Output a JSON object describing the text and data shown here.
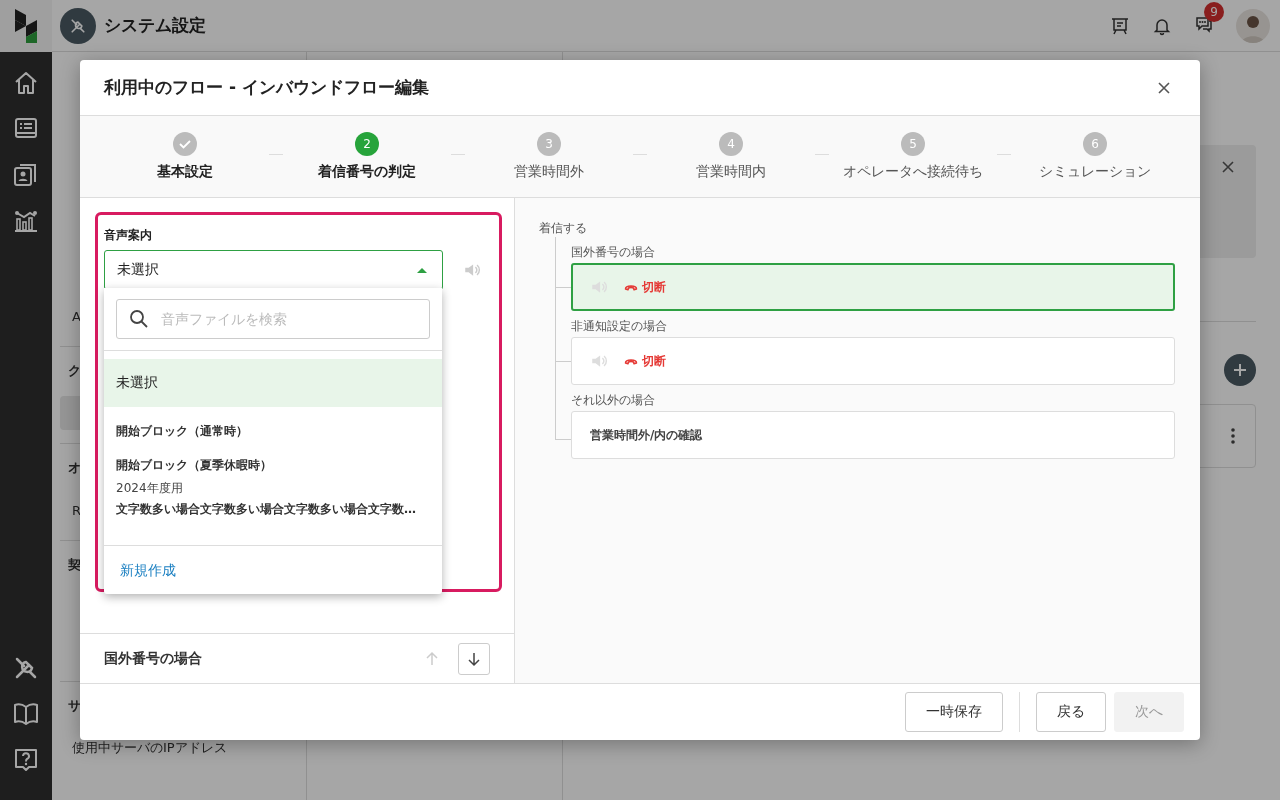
{
  "app": {
    "title": "システム設定",
    "chat_badge": "9"
  },
  "background_nav": {
    "items": [
      {
        "kind": "item",
        "text": "A",
        "selected": false
      },
      {
        "kind": "heading",
        "text": "ク"
      },
      {
        "kind": "item",
        "selected": true
      },
      {
        "kind": "heading",
        "text": "オ"
      },
      {
        "kind": "item",
        "text": "R",
        "selected": false
      },
      {
        "kind": "heading",
        "text": "契"
      },
      {
        "kind": "heading",
        "text": "サ"
      },
      {
        "kind": "item",
        "text": "使用中サーバのIPアドレス",
        "selected": false
      }
    ]
  },
  "modal": {
    "title": "利用中のフロー - インバウンドフロー編集",
    "steps": [
      {
        "label": "基本設定",
        "completed": true,
        "selected": false
      },
      {
        "number": "2",
        "label": "着信番号の判定",
        "completed": false,
        "selected": true
      },
      {
        "number": "3",
        "label": "営業時間外",
        "completed": false,
        "selected": false
      },
      {
        "number": "4",
        "label": "営業時間内",
        "completed": false,
        "selected": false
      },
      {
        "number": "5",
        "label": "オペレータへ接続待ち",
        "completed": false,
        "selected": false
      },
      {
        "number": "6",
        "label": "シミュレーション",
        "completed": false,
        "selected": false
      }
    ],
    "voice_guide": {
      "label": "音声案内",
      "value": "未選択",
      "expanded": true,
      "search_placeholder": "音声ファイルを検索",
      "options": [
        {
          "kind": "empty",
          "title": "未選択",
          "selected": true
        },
        {
          "kind": "file",
          "title": "開始ブロック（通常時）",
          "selected": false
        },
        {
          "kind": "file",
          "title": "開始ブロック（夏季休暇時）",
          "subtitle": "2024年度用",
          "selected": false
        },
        {
          "kind": "file",
          "title": "文字数多い場合文字数多い場合文字数多い場合文字数…",
          "selected": false
        }
      ],
      "create_link": "新規作成"
    },
    "section": {
      "title": "国外番号の場合",
      "move_up_disabled": true,
      "move_down_disabled": false
    },
    "flow": {
      "root": "着信する",
      "branches": [
        {
          "condition": "国外番号の場合",
          "kind": "hangup",
          "action": "切断",
          "selected": true
        },
        {
          "condition": "非通知設定の場合",
          "kind": "hangup",
          "action": "切断",
          "selected": false
        },
        {
          "condition": "それ以外の場合",
          "kind": "step",
          "action": "営業時間外/内の確認",
          "selected": false
        }
      ]
    },
    "footer": {
      "buttons": [
        {
          "label": "一時保存",
          "disabled": false
        },
        {
          "label": "戻る",
          "disabled": false
        },
        {
          "label": "次へ",
          "disabled": true
        }
      ]
    }
  }
}
